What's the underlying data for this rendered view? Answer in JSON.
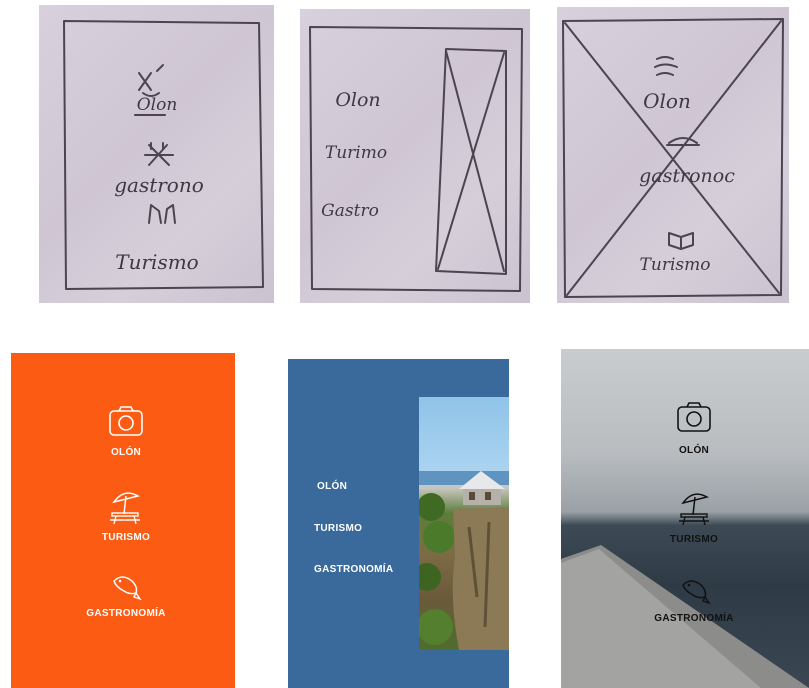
{
  "sketches": {
    "a": {
      "item1": "Olon",
      "item2": "gastrono",
      "item3": "Turismo"
    },
    "b": {
      "item1": "Olon",
      "item2": "Turimo",
      "item3": "Gastro"
    },
    "c": {
      "item1": "Olon",
      "item2": "gastronoc",
      "item3": "Turismo"
    }
  },
  "mockups": {
    "orange": {
      "bg": "#fb5b13",
      "items": [
        {
          "label": "OLÓN",
          "icon": "camera-icon"
        },
        {
          "label": "TURISMO",
          "icon": "umbrella-picnic-table-icon"
        },
        {
          "label": "GASTRONOMÍA",
          "icon": "fish-icon"
        }
      ]
    },
    "blue": {
      "bg": "#3a6a9c",
      "items": [
        {
          "label": "OLÓN"
        },
        {
          "label": "TURISMO"
        },
        {
          "label": "GASTRONOMÍA"
        }
      ]
    },
    "photo": {
      "items": [
        {
          "label": "OLÓN",
          "icon": "camera-icon"
        },
        {
          "label": "TURISMO",
          "icon": "umbrella-picnic-table-icon"
        },
        {
          "label": "GASTRONOMÍA",
          "icon": "fish-icon"
        }
      ]
    }
  }
}
